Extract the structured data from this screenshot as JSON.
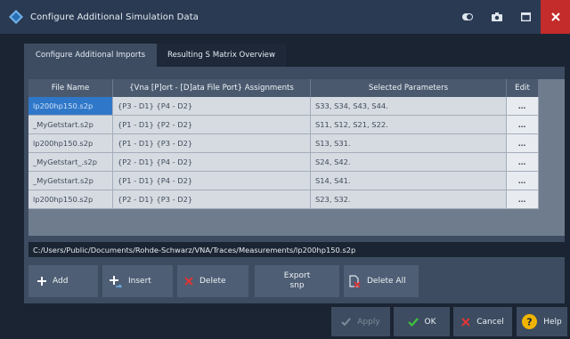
{
  "window": {
    "title": "Configure Additional Simulation Data"
  },
  "tabs": [
    {
      "label": "Configure Additional Imports",
      "active": true
    },
    {
      "label": "Resulting S Matrix Overview",
      "active": false
    }
  ],
  "table": {
    "headers": [
      "File Name",
      "{Vna [P]ort - [D]ata File Port} Assignments",
      "Selected Parameters",
      "Edit"
    ],
    "rows": [
      {
        "file": "lp200hp150.s2p",
        "assign": "{P3 - D1} {P4 - D2}",
        "params": "S33, S34, S43, S44.",
        "edit": "…"
      },
      {
        "file": "_MyGetstart.s2p",
        "assign": "{P1 - D1} {P2 - D2}",
        "params": "S11, S12, S21, S22.",
        "edit": "…"
      },
      {
        "file": "lp200hp150.s2p",
        "assign": "{P1 - D1} {P3 - D2}",
        "params": "S13, S31.",
        "edit": "…"
      },
      {
        "file": "_MyGetstart_.s2p",
        "assign": "{P2 - D1} {P4 - D2}",
        "params": "S24, S42.",
        "edit": "…"
      },
      {
        "file": "_MyGetstart.s2p",
        "assign": "{P1 - D1} {P4 - D2}",
        "params": "S14, S41.",
        "edit": "…"
      },
      {
        "file": "lp200hp150.s2p",
        "assign": "{P2 - D1} {P3 - D2}",
        "params": "S23, S32.",
        "edit": "…"
      }
    ]
  },
  "path": "C:/Users/Public/Documents/Rohde-Schwarz/VNA/Traces/Measurements/lp200hp150.s2p",
  "actions": {
    "add": "Add",
    "insert": "Insert",
    "delete": "Delete",
    "export_line1": "Export",
    "export_line2": "snp",
    "delete_all": "Delete All"
  },
  "footer": {
    "apply": "Apply",
    "ok": "OK",
    "cancel": "Cancel",
    "help": "Help"
  },
  "colors": {
    "accent": "#2f78c9",
    "close": "#c42b2b",
    "ok_check": "#3cc43c",
    "delete_x": "#e03535",
    "help_badge": "#f0b400"
  }
}
